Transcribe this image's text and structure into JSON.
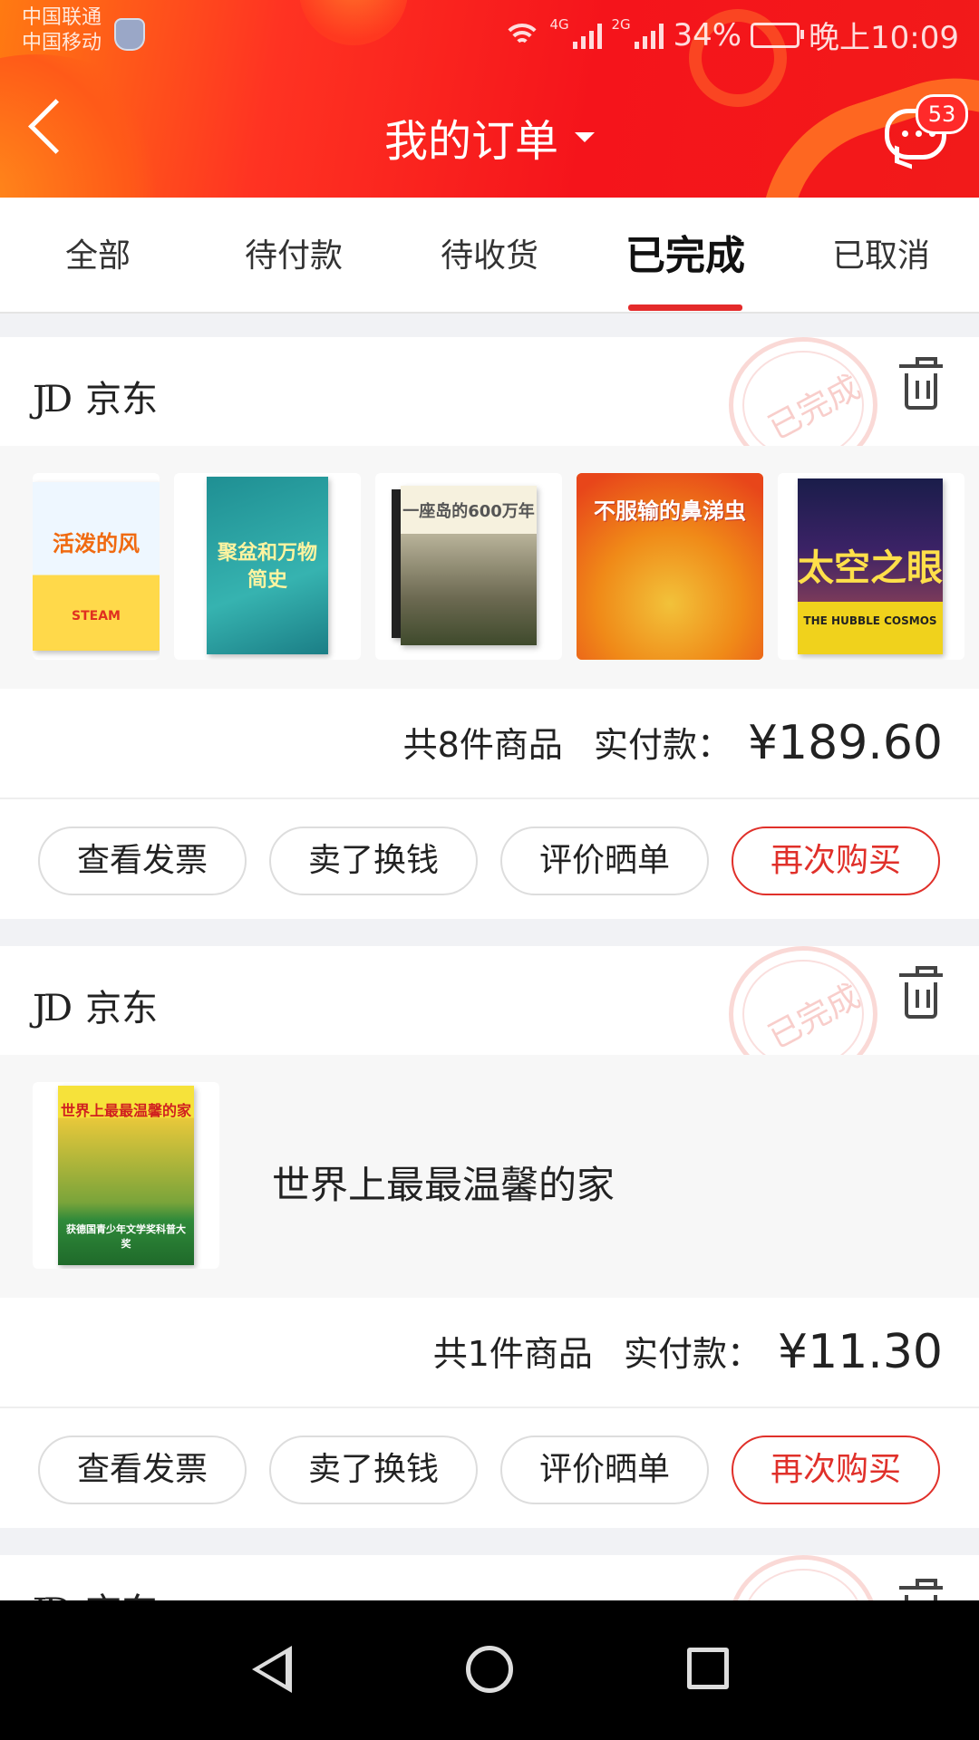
{
  "status_bar": {
    "carrier_1": "中国联通",
    "carrier_2": "中国移动",
    "net_1": "4G",
    "net_2": "2G",
    "battery": "34%",
    "time": "晚上10:09"
  },
  "header": {
    "title": "我的订单",
    "message_badge": "53",
    "icons": [
      "back-icon",
      "caret-down-icon",
      "message-icon"
    ]
  },
  "tabs": [
    {
      "label": "全部",
      "active": false
    },
    {
      "label": "待付款",
      "active": false
    },
    {
      "label": "待收货",
      "active": false
    },
    {
      "label": "已完成",
      "active": true
    },
    {
      "label": "已取消",
      "active": false
    }
  ],
  "orders": [
    {
      "shop": "京东",
      "shop_logo": "JD",
      "stamp": "已完成",
      "books": [
        {
          "cover_text": "活泼的风",
          "sub": "STEAM"
        },
        {
          "cover_text": "聚盆和万物简史"
        },
        {
          "cover_text": "一座岛的600万年"
        },
        {
          "cover_text": "不服输的鼻涕虫"
        },
        {
          "cover_text": "太空之眼",
          "sub": "THE HUBBLE COSMOS"
        }
      ],
      "count_text": "共8件商品",
      "paid_label": "实付款：",
      "price": "¥189.60",
      "buttons": [
        "查看发票",
        "卖了换钱",
        "评价晒单",
        "再次购买"
      ]
    },
    {
      "shop": "京东",
      "shop_logo": "JD",
      "stamp": "已完成",
      "book": {
        "cover_text": "世界上最最温馨的家",
        "sub": "获德国青少年文学奖科普大奖"
      },
      "title": "世界上最最温馨的家",
      "count_text": "共1件商品",
      "paid_label": "实付款：",
      "price": "¥11.30",
      "buttons": [
        "查看发票",
        "卖了换钱",
        "评价晒单",
        "再次购买"
      ]
    },
    {
      "shop": "京东",
      "shop_logo": "JD"
    }
  ],
  "colors": {
    "accent": "#e0302a",
    "header_red": "#f5141b",
    "header_orange": "#ff7a12"
  }
}
